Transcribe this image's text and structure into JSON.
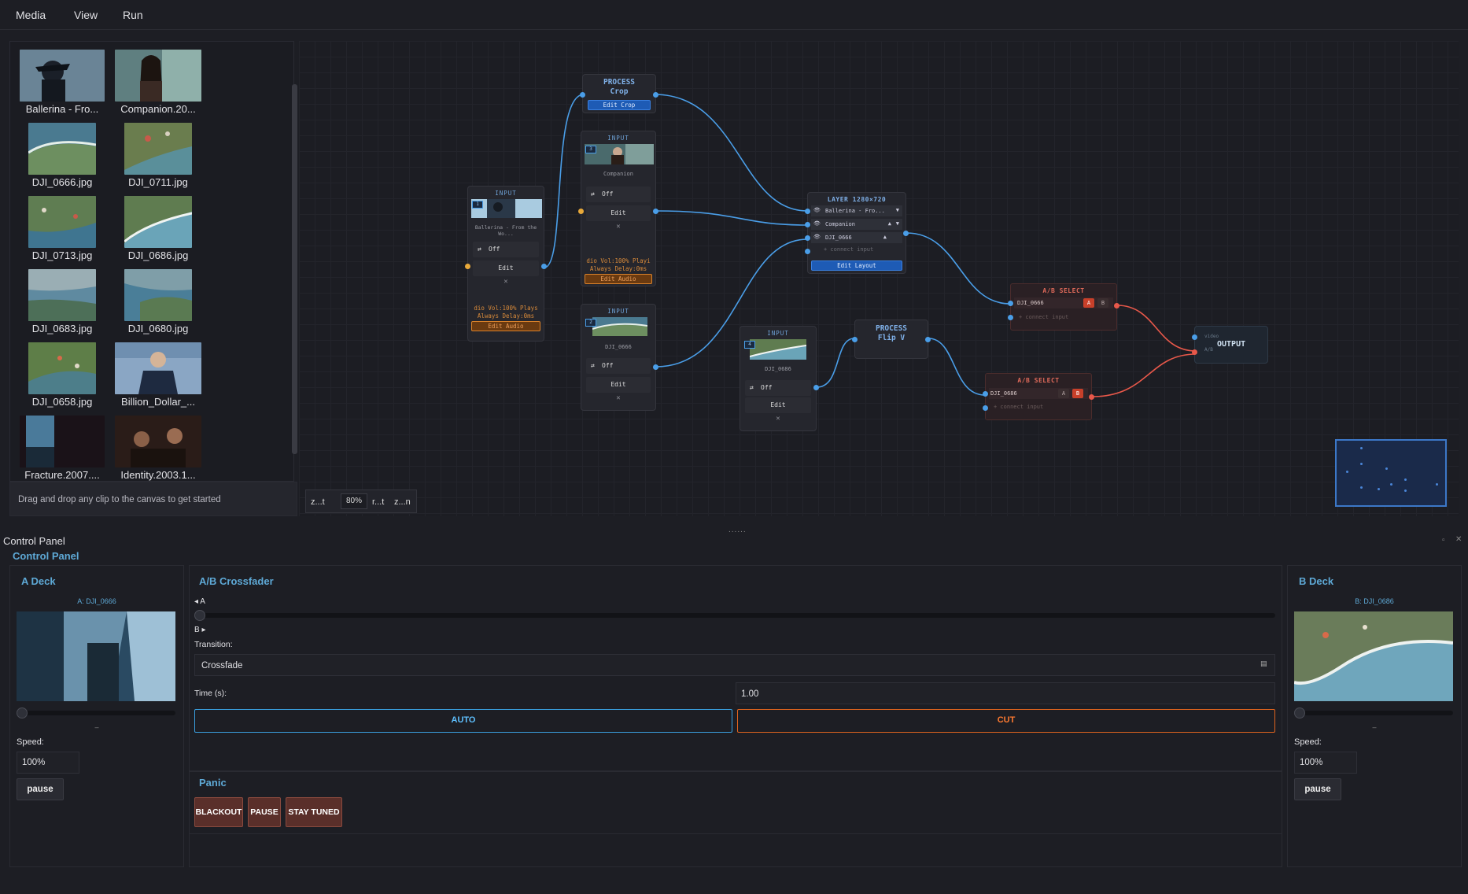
{
  "menu": {
    "items": [
      "Media",
      "View",
      "Run"
    ]
  },
  "library": {
    "clips": [
      {
        "caption": "Ballerina - Fro..."
      },
      {
        "caption": "Companion.20..."
      },
      {
        "caption": "DJI_0666.jpg"
      },
      {
        "caption": "DJI_0711.jpg"
      },
      {
        "caption": "DJI_0713.jpg"
      },
      {
        "caption": "DJI_0686.jpg"
      },
      {
        "caption": "DJI_0683.jpg"
      },
      {
        "caption": "DJI_0680.jpg"
      },
      {
        "caption": "DJI_0658.jpg"
      },
      {
        "caption": "Billion_Dollar_..."
      },
      {
        "caption": "Fracture.2007...."
      },
      {
        "caption": "Identity.2003.1..."
      }
    ],
    "hint": "Drag and drop any clip to the canvas to get started"
  },
  "canvas": {
    "zoom": {
      "left_label": "z...t",
      "value": "80%",
      "mid_label": "r...t",
      "right_label": "z...n"
    },
    "nodes": {
      "process_crop": {
        "label": "PROCESS",
        "name": "Crop",
        "button": "Edit Crop"
      },
      "input_companion": {
        "label": "INPUT",
        "badge": "3",
        "name": "Companion",
        "toggle": "Off",
        "edit": "Edit",
        "remove": "✕",
        "audio1": "dio  Vol:100%  Playi",
        "audio2": "Always  Delay:0ms",
        "audio_btn": "Edit Audio"
      },
      "input_ballerina": {
        "label": "INPUT",
        "badge": "1",
        "name": "Ballerina - From the Wo...",
        "toggle": "Off",
        "edit": "Edit",
        "remove": "✕",
        "audio1": "dio  Vol:100%  Plays",
        "audio2": "Always  Delay:0ms",
        "audio_btn": "Edit Audio"
      },
      "input_dji0666": {
        "label": "INPUT",
        "badge": "2",
        "name": "DJI_0666",
        "toggle": "Off",
        "edit": "Edit",
        "remove": "✕"
      },
      "input_dji0686": {
        "label": "INPUT",
        "badge": "4",
        "name": "DJI_0686",
        "toggle": "Off",
        "edit": "Edit",
        "remove": "✕"
      },
      "process_flip": {
        "label": "PROCESS",
        "name": "Flip V"
      },
      "layer": {
        "title": "LAYER  1280×720",
        "row1": "Ballerina - Fro...",
        "row2": "Companion",
        "row3": "DJI_0666",
        "connect": "+ connect input",
        "button": "Edit Layout"
      },
      "ab1": {
        "title": "A/B SELECT",
        "row": "DJI_0666",
        "a": "A",
        "b": "B",
        "connect": "+ connect input"
      },
      "ab2": {
        "title": "A/B SELECT",
        "row": "DJI_0686",
        "a": "A",
        "b": "B",
        "connect": "+ connect input"
      },
      "output": {
        "title": "OUTPUT",
        "video": "video",
        "ab": "A/B"
      }
    }
  },
  "control_panel": {
    "handle": "......",
    "header": "Control Panel",
    "subtitle": "Control Panel",
    "a_deck": {
      "title": "A Deck",
      "source": "A: DJI_0666",
      "dash": "–",
      "speed_label": "Speed:",
      "speed": "100%",
      "pause": "pause"
    },
    "crossfader": {
      "title": "A/B Crossfader",
      "a_label": "◂ A",
      "b_label": "B ▸",
      "transition_label": "Transition:",
      "transition": "Crossfade",
      "time_label": "Time (s):",
      "time": "1.00",
      "auto": "AUTO",
      "cut": "CUT"
    },
    "panic": {
      "title": "Panic",
      "blackout": "BLACKOUT",
      "pause": "PAUSE",
      "stay_tuned": "STAY TUNED"
    },
    "b_deck": {
      "title": "B Deck",
      "source": "B: DJI_0686",
      "dash": "–",
      "speed_label": "Speed:",
      "speed": "100%",
      "pause": "pause"
    }
  },
  "colors": {
    "accent": "#5ea9d6",
    "auto_border": "#3aa0e0",
    "cut_border": "#e0641e",
    "wire_blue": "#4a9ee8",
    "wire_red": "#e8584a"
  }
}
